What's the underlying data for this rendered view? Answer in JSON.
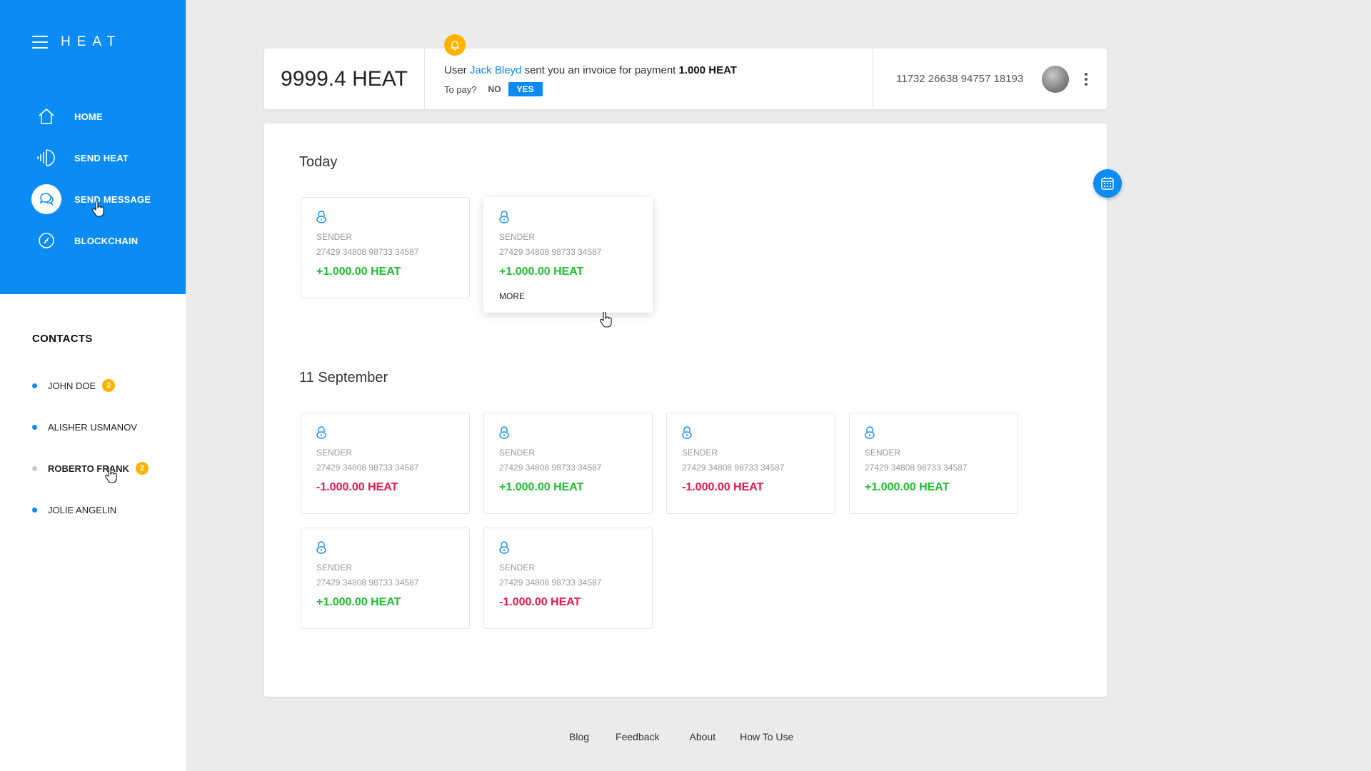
{
  "brand": {
    "name": "HEAT"
  },
  "nav": {
    "items": [
      {
        "label": "HOME",
        "icon": "home-icon"
      },
      {
        "label": "SEND HEAT",
        "icon": "send-heat-icon"
      },
      {
        "label": "SEND MESSAGE",
        "icon": "message-icon",
        "active": true
      },
      {
        "label": "BLOCKCHAIN",
        "icon": "blockchain-icon"
      }
    ]
  },
  "contacts": {
    "title": "CONTACTS",
    "items": [
      {
        "name": "JOHN DOE",
        "badge": "2",
        "online": true
      },
      {
        "name": "ALISHER USMANOV",
        "online": true
      },
      {
        "name": "ROBERTO FRANK",
        "badge": "2",
        "online": false
      },
      {
        "name": "JOLIE ANGELIN",
        "online": true
      }
    ]
  },
  "topbar": {
    "balance": "9999.4 HEAT",
    "notice": {
      "prefix": "User",
      "user": "Jack Bleyd",
      "middle": "sent you an invoice for payment",
      "amount": "1.000 HEAT",
      "question": "To pay?",
      "no_label": "NO",
      "yes_label": "YES"
    },
    "account_id": "11732 26638 94757 18193"
  },
  "sections": [
    {
      "title": "Today",
      "cards": [
        {
          "label": "SENDER",
          "id": "27429 34808 98733 34587",
          "amount": "+1.000.00 HEAT",
          "sign": "pos"
        },
        {
          "label": "SENDER",
          "id": "27429 34808 98733 34587",
          "amount": "+1.000.00 HEAT",
          "sign": "pos",
          "more": "MORE"
        }
      ]
    },
    {
      "title": "11 September",
      "cards": [
        {
          "label": "SENDER",
          "id": "27429 34808 98733 34587",
          "amount": "-1.000.00 HEAT",
          "sign": "neg"
        },
        {
          "label": "SENDER",
          "id": "27429 34808 98733 34587",
          "amount": "+1.000.00 HEAT",
          "sign": "pos"
        },
        {
          "label": "SENDER",
          "id": "27429 34808 98733 34587",
          "amount": "-1.000.00 HEAT",
          "sign": "neg"
        },
        {
          "label": "SENDER",
          "id": "27429 34808 98733 34587",
          "amount": "+1.000.00 HEAT",
          "sign": "pos"
        },
        {
          "label": "SENDER",
          "id": "27429 34808 98733 34587",
          "amount": "+1.000.00 HEAT",
          "sign": "pos"
        },
        {
          "label": "SENDER",
          "id": "27429 34808 98733 34587",
          "amount": "-1.000.00 HEAT",
          "sign": "neg"
        }
      ]
    }
  ],
  "footer": {
    "links": [
      "Blog",
      "Feedback",
      "About",
      "How To Use"
    ]
  },
  "colors": {
    "accent": "#0b8cf4",
    "positive": "#1fbd31",
    "negative": "#e8174c",
    "badge": "#ffb300"
  }
}
